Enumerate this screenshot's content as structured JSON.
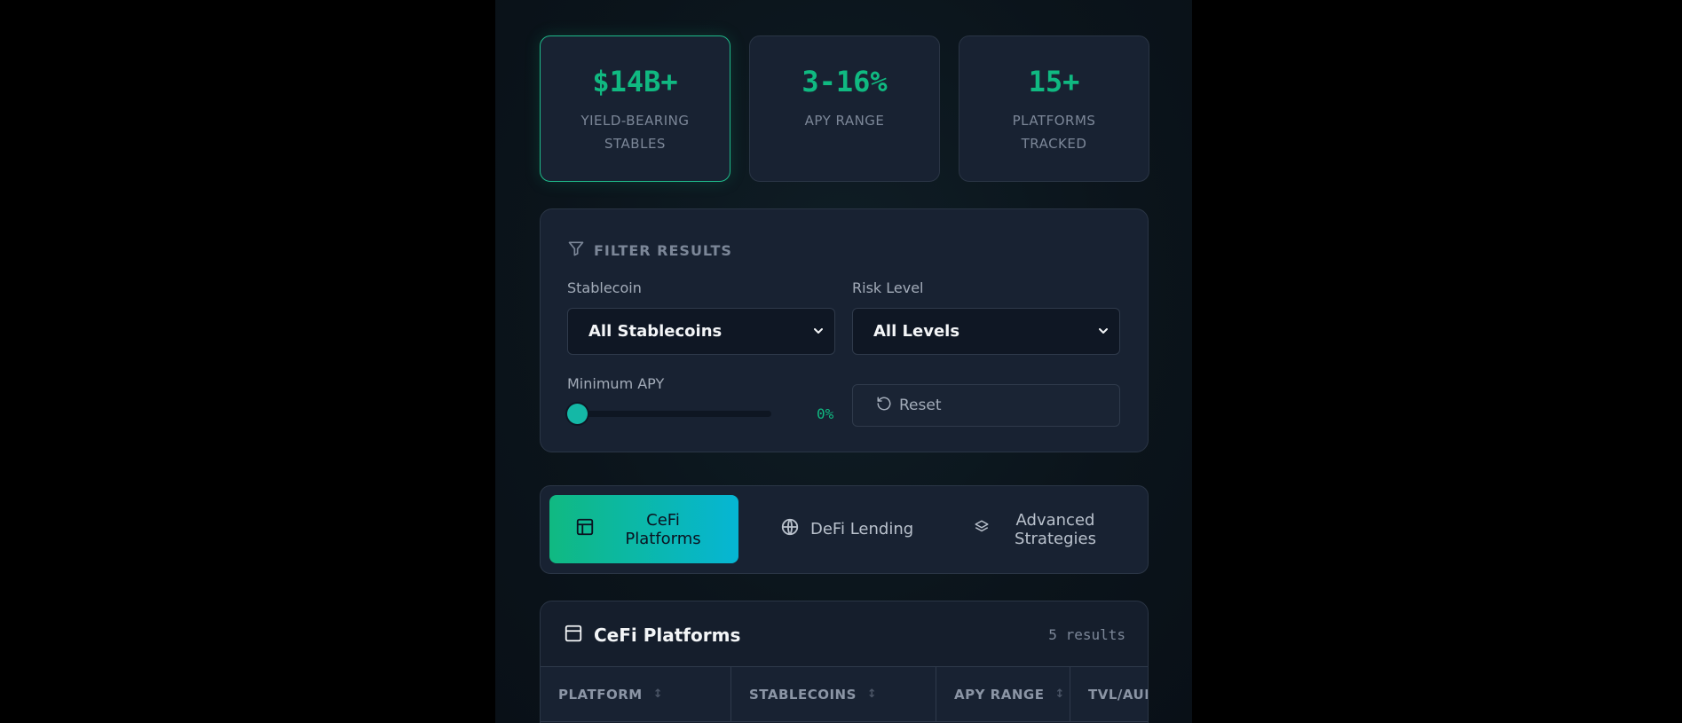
{
  "stats": [
    {
      "value": "$14B+",
      "label": "YIELD-BEARING STABLES"
    },
    {
      "value": "3-16%",
      "label": "APY RANGE"
    },
    {
      "value": "15+",
      "label": "PLATFORMS TRACKED"
    }
  ],
  "filter": {
    "title": "FILTER RESULTS",
    "stablecoin_label": "Stablecoin",
    "stablecoin_value": "All Stablecoins",
    "risk_label": "Risk Level",
    "risk_value": "All Levels",
    "min_apy_label": "Minimum APY",
    "min_apy_value": "0%",
    "min_apy_fraction": 0,
    "reset_label": "Reset"
  },
  "tabs": [
    {
      "label": "CeFi Platforms",
      "icon": "layout-icon",
      "active": true
    },
    {
      "label": "DeFi Lending",
      "icon": "globe-icon",
      "active": false
    },
    {
      "label": "Advanced Strategies",
      "icon": "layers-icon",
      "active": false
    }
  ],
  "table": {
    "title": "CeFi Platforms",
    "count": "5 results",
    "columns": [
      "PLATFORM",
      "STABLECOINS",
      "APY RANGE",
      "TVL/AUM"
    ]
  },
  "colors": {
    "accent": "#10b981",
    "accent2": "#06b6d4",
    "panel": "#182232",
    "background": "#000000"
  }
}
